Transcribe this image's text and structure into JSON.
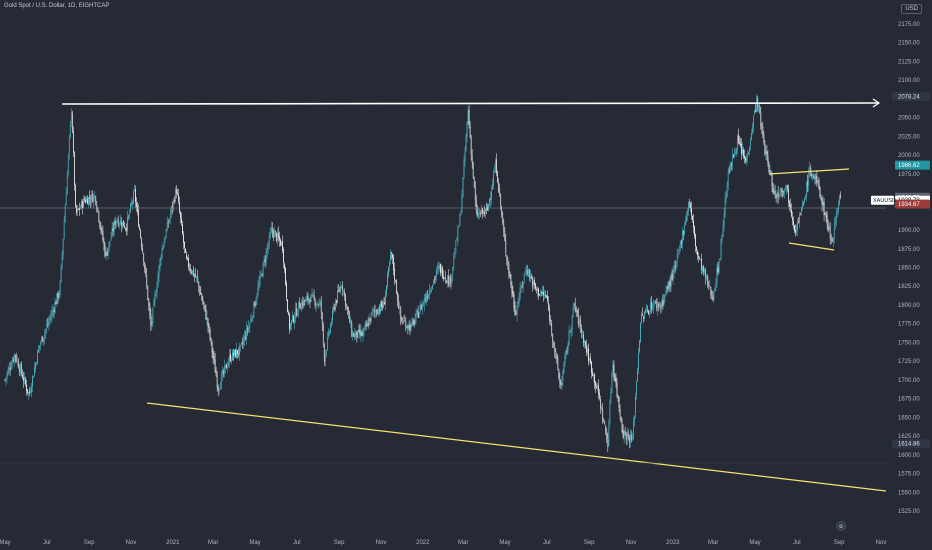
{
  "header": {
    "title": "Gold Spot / U.S. Dollar, 1D, EIGHTCAP",
    "currency": "USD"
  },
  "chart_data": {
    "type": "candlestick",
    "symbol": "XAUUSD",
    "x_tick_labels": [
      "May",
      "Jul",
      "Sep",
      "Nov",
      "2021",
      "Mar",
      "May",
      "Jul",
      "Sep",
      "Nov",
      "2022",
      "Mar",
      "May",
      "Jul",
      "Sep",
      "Nov",
      "2023",
      "Mar",
      "May",
      "Jul",
      "Sep",
      "Nov"
    ],
    "y_tick_labels": [
      "2175.00",
      "2150.00",
      "2125.00",
      "2100.00",
      "2050.00",
      "2025.00",
      "2000.00",
      "1975.00",
      "1900.00",
      "1875.00",
      "1850.00",
      "1825.00",
      "1800.00",
      "1775.00",
      "1750.00",
      "1725.00",
      "1700.00",
      "1675.00",
      "1650.00",
      "1625.00",
      "1600.00",
      "1575.00",
      "1550.00",
      "1525.00"
    ],
    "ylim": [
      1525,
      2175
    ],
    "high": {
      "label": "High",
      "value": "2078.24"
    },
    "low": {
      "label": "Low",
      "value": "1614.86"
    },
    "price_labels": [
      {
        "value": "1986.62",
        "color": "#2196a3"
      },
      {
        "value": "1943.72",
        "color": "#5f6470"
      },
      {
        "value": "1939.78",
        "color": "#ffffff",
        "text_color": "#131722",
        "note": "XAUUSD"
      },
      {
        "value": "1934.67",
        "color": "#9c3b3b"
      }
    ],
    "current_price": 1939.78,
    "price_path": [
      [
        "2020-05-01",
        1700
      ],
      [
        "2020-05-15",
        1735
      ],
      [
        "2020-06-05",
        1680
      ],
      [
        "2020-06-20",
        1745
      ],
      [
        "2020-07-05",
        1780
      ],
      [
        "2020-07-20",
        1820
      ],
      [
        "2020-08-06",
        2065
      ],
      [
        "2020-08-12",
        1920
      ],
      [
        "2020-08-25",
        1940
      ],
      [
        "2020-09-10",
        1945
      ],
      [
        "2020-09-25",
        1865
      ],
      [
        "2020-10-10",
        1915
      ],
      [
        "2020-10-25",
        1905
      ],
      [
        "2020-11-06",
        1950
      ],
      [
        "2020-11-20",
        1860
      ],
      [
        "2020-11-30",
        1770
      ],
      [
        "2020-12-15",
        1870
      ],
      [
        "2021-01-06",
        1955
      ],
      [
        "2021-01-20",
        1860
      ],
      [
        "2021-02-05",
        1835
      ],
      [
        "2021-02-20",
        1780
      ],
      [
        "2021-03-08",
        1690
      ],
      [
        "2021-03-25",
        1730
      ],
      [
        "2021-04-10",
        1740
      ],
      [
        "2021-04-25",
        1780
      ],
      [
        "2021-05-10",
        1840
      ],
      [
        "2021-05-25",
        1900
      ],
      [
        "2021-06-10",
        1880
      ],
      [
        "2021-06-20",
        1770
      ],
      [
        "2021-07-05",
        1800
      ],
      [
        "2021-07-20",
        1810
      ],
      [
        "2021-08-05",
        1800
      ],
      [
        "2021-08-10",
        1730
      ],
      [
        "2021-08-25",
        1800
      ],
      [
        "2021-09-05",
        1830
      ],
      [
        "2021-09-20",
        1760
      ],
      [
        "2021-10-05",
        1760
      ],
      [
        "2021-10-20",
        1790
      ],
      [
        "2021-11-05",
        1800
      ],
      [
        "2021-11-16",
        1870
      ],
      [
        "2021-11-30",
        1780
      ],
      [
        "2021-12-15",
        1770
      ],
      [
        "2022-01-05",
        1810
      ],
      [
        "2022-01-25",
        1850
      ],
      [
        "2022-02-10",
        1830
      ],
      [
        "2022-02-25",
        1920
      ],
      [
        "2022-03-08",
        2060
      ],
      [
        "2022-03-20",
        1920
      ],
      [
        "2022-04-05",
        1925
      ],
      [
        "2022-04-18",
        1990
      ],
      [
        "2022-05-01",
        1880
      ],
      [
        "2022-05-16",
        1790
      ],
      [
        "2022-06-01",
        1850
      ],
      [
        "2022-06-15",
        1820
      ],
      [
        "2022-07-01",
        1810
      ],
      [
        "2022-07-21",
        1690
      ],
      [
        "2022-08-10",
        1800
      ],
      [
        "2022-08-25",
        1750
      ],
      [
        "2022-09-15",
        1680
      ],
      [
        "2022-09-28",
        1615
      ],
      [
        "2022-10-05",
        1725
      ],
      [
        "2022-10-20",
        1630
      ],
      [
        "2022-11-03",
        1620
      ],
      [
        "2022-11-15",
        1780
      ],
      [
        "2022-12-01",
        1800
      ],
      [
        "2022-12-15",
        1800
      ],
      [
        "2023-01-05",
        1850
      ],
      [
        "2023-01-25",
        1940
      ],
      [
        "2023-02-05",
        1870
      ],
      [
        "2023-02-28",
        1810
      ],
      [
        "2023-03-10",
        1860
      ],
      [
        "2023-03-22",
        1970
      ],
      [
        "2023-04-05",
        2020
      ],
      [
        "2023-04-18",
        1990
      ],
      [
        "2023-05-04",
        2075
      ],
      [
        "2023-05-15",
        2010
      ],
      [
        "2023-05-30",
        1945
      ],
      [
        "2023-06-15",
        1960
      ],
      [
        "2023-06-29",
        1900
      ],
      [
        "2023-07-10",
        1930
      ],
      [
        "2023-07-20",
        1980
      ],
      [
        "2023-08-01",
        1960
      ],
      [
        "2023-08-21",
        1885
      ],
      [
        "2023-09-01",
        1945
      ],
      [
        "2023-09-04",
        1939.78
      ]
    ],
    "grid": false,
    "legend": "none"
  }
}
